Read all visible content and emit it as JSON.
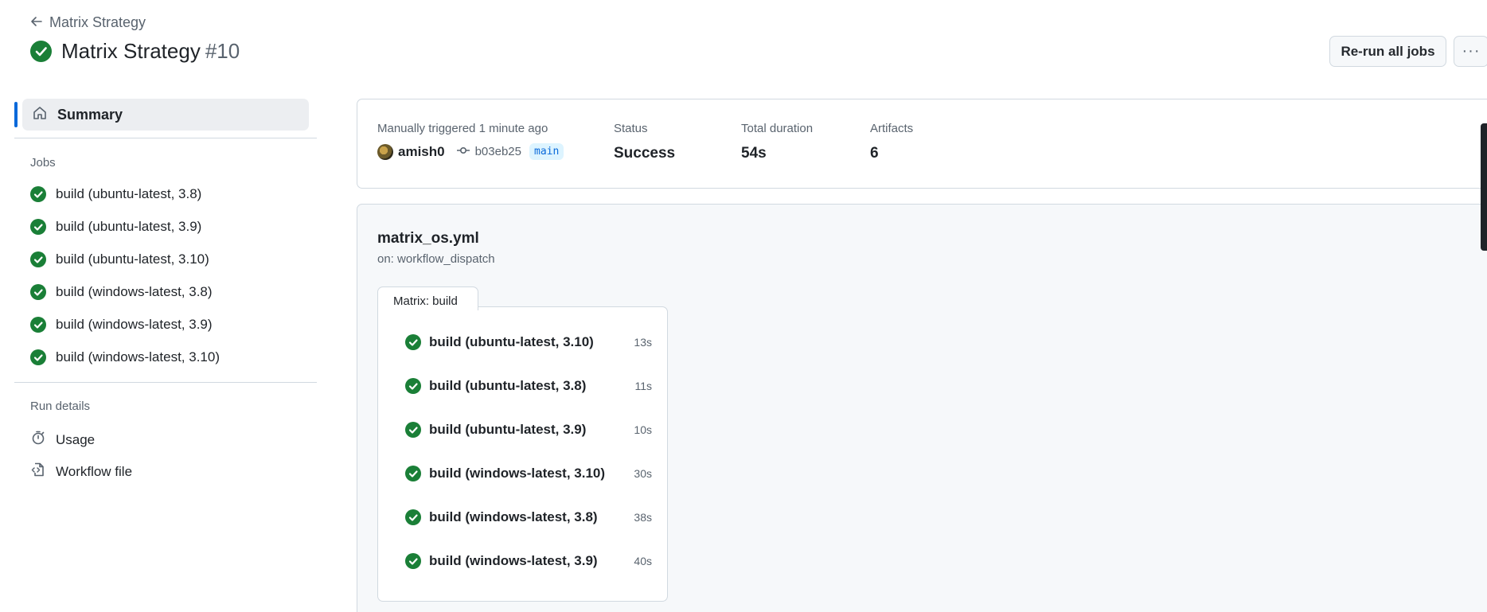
{
  "header": {
    "back_label": "Matrix Strategy",
    "title": "Matrix Strategy",
    "run_number": "#10",
    "status": "success",
    "rerun_label": "Re-run all jobs",
    "more_label": "···"
  },
  "sidebar": {
    "summary_label": "Summary",
    "jobs_title": "Jobs",
    "jobs": [
      {
        "label": "build (ubuntu-latest, 3.8)",
        "status": "success"
      },
      {
        "label": "build (ubuntu-latest, 3.9)",
        "status": "success"
      },
      {
        "label": "build (ubuntu-latest, 3.10)",
        "status": "success"
      },
      {
        "label": "build (windows-latest, 3.8)",
        "status": "success"
      },
      {
        "label": "build (windows-latest, 3.9)",
        "status": "success"
      },
      {
        "label": "build (windows-latest, 3.10)",
        "status": "success"
      }
    ],
    "run_details_title": "Run details",
    "details": [
      {
        "label": "Usage",
        "icon": "stopwatch-icon"
      },
      {
        "label": "Workflow file",
        "icon": "file-code-icon"
      }
    ]
  },
  "info": {
    "trigger_label": "Manually triggered 1 minute ago",
    "actor": "amish0",
    "commit": "b03eb25",
    "branch": "main",
    "status_label": "Status",
    "status_value": "Success",
    "duration_label": "Total duration",
    "duration_value": "54s",
    "artifacts_label": "Artifacts",
    "artifacts_value": "6"
  },
  "workflow": {
    "file_name": "matrix_os.yml",
    "trigger": "on: workflow_dispatch",
    "matrix_label": "Matrix: build",
    "jobs": [
      {
        "label": "build (ubuntu-latest, 3.10)",
        "duration": "13s"
      },
      {
        "label": "build (ubuntu-latest, 3.8)",
        "duration": "11s"
      },
      {
        "label": "build (ubuntu-latest, 3.9)",
        "duration": "10s"
      },
      {
        "label": "build (windows-latest, 3.10)",
        "duration": "30s"
      },
      {
        "label": "build (windows-latest, 3.8)",
        "duration": "38s"
      },
      {
        "label": "build (windows-latest, 3.9)",
        "duration": "40s"
      }
    ]
  },
  "colors": {
    "success": "#1a7f37",
    "accent": "#0969da",
    "border": "#d1d9e0",
    "muted": "#59636e"
  }
}
